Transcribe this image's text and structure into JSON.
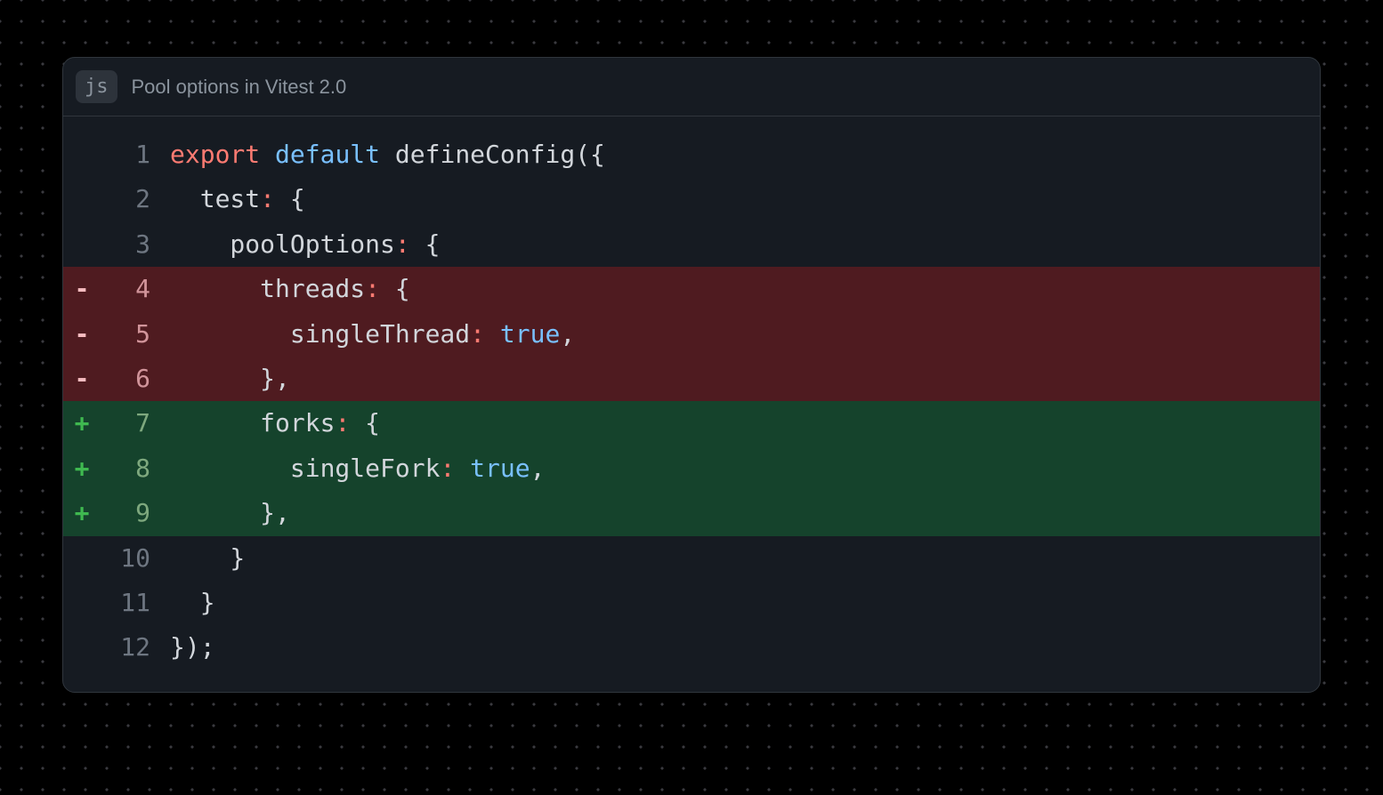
{
  "header": {
    "lang_badge": "js",
    "title": "Pool options in Vitest 2.0"
  },
  "code": {
    "total_lines": 12,
    "lines": [
      {
        "n": 1,
        "diff": "none",
        "tokens": [
          {
            "t": "export",
            "c": "kw-export"
          },
          {
            "t": " ",
            "c": "plain"
          },
          {
            "t": "default",
            "c": "kw-default"
          },
          {
            "t": " ",
            "c": "plain"
          },
          {
            "t": "defineConfig",
            "c": "fn"
          },
          {
            "t": "({",
            "c": "punct"
          }
        ]
      },
      {
        "n": 2,
        "diff": "none",
        "tokens": [
          {
            "t": "  test",
            "c": "prop"
          },
          {
            "t": ":",
            "c": "colon"
          },
          {
            "t": " {",
            "c": "punct"
          }
        ]
      },
      {
        "n": 3,
        "diff": "none",
        "tokens": [
          {
            "t": "    poolOptions",
            "c": "prop"
          },
          {
            "t": ":",
            "c": "colon"
          },
          {
            "t": " {",
            "c": "punct"
          }
        ]
      },
      {
        "n": 4,
        "diff": "remove",
        "tokens": [
          {
            "t": "      threads",
            "c": "prop"
          },
          {
            "t": ":",
            "c": "colon"
          },
          {
            "t": " {",
            "c": "punct"
          }
        ]
      },
      {
        "n": 5,
        "diff": "remove",
        "tokens": [
          {
            "t": "        singleThread",
            "c": "prop"
          },
          {
            "t": ":",
            "c": "colon"
          },
          {
            "t": " ",
            "c": "plain"
          },
          {
            "t": "true",
            "c": "bool"
          },
          {
            "t": ",",
            "c": "punct"
          }
        ]
      },
      {
        "n": 6,
        "diff": "remove",
        "tokens": [
          {
            "t": "      },",
            "c": "punct"
          }
        ]
      },
      {
        "n": 7,
        "diff": "add",
        "tokens": [
          {
            "t": "      forks",
            "c": "prop"
          },
          {
            "t": ":",
            "c": "colon"
          },
          {
            "t": " {",
            "c": "punct"
          }
        ]
      },
      {
        "n": 8,
        "diff": "add",
        "tokens": [
          {
            "t": "        singleFork",
            "c": "prop"
          },
          {
            "t": ":",
            "c": "colon"
          },
          {
            "t": " ",
            "c": "plain"
          },
          {
            "t": "true",
            "c": "bool"
          },
          {
            "t": ",",
            "c": "punct"
          }
        ]
      },
      {
        "n": 9,
        "diff": "add",
        "tokens": [
          {
            "t": "      },",
            "c": "punct"
          }
        ]
      },
      {
        "n": 10,
        "diff": "none",
        "tokens": [
          {
            "t": "    }",
            "c": "punct"
          }
        ]
      },
      {
        "n": 11,
        "diff": "none",
        "tokens": [
          {
            "t": "  }",
            "c": "punct"
          }
        ]
      },
      {
        "n": 12,
        "diff": "none",
        "tokens": [
          {
            "t": "});",
            "c": "punct"
          }
        ]
      }
    ]
  }
}
